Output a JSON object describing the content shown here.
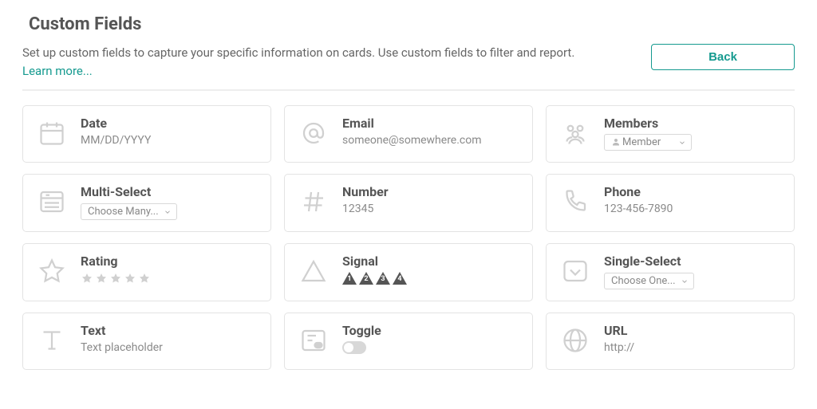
{
  "page": {
    "title": "Custom Fields",
    "intro": "Set up custom fields to capture your specific information on cards. Use custom fields to filter and report.",
    "learn_more": "Learn more...",
    "back_label": "Back"
  },
  "fields": {
    "date": {
      "title": "Date",
      "example": "MM/DD/YYYY"
    },
    "email": {
      "title": "Email",
      "example": "someone@somewhere.com"
    },
    "members": {
      "title": "Members",
      "select_label": "Member"
    },
    "multi_select": {
      "title": "Multi-Select",
      "select_label": "Choose Many..."
    },
    "number": {
      "title": "Number",
      "example": "12345"
    },
    "phone": {
      "title": "Phone",
      "example": "123-456-7890"
    },
    "rating": {
      "title": "Rating"
    },
    "signal": {
      "title": "Signal",
      "levels": [
        "1",
        "2",
        "3",
        "4"
      ]
    },
    "single_select": {
      "title": "Single-Select",
      "select_label": "Choose One..."
    },
    "text": {
      "title": "Text",
      "example": "Text placeholder"
    },
    "toggle": {
      "title": "Toggle"
    },
    "url": {
      "title": "URL",
      "example": "http://"
    }
  }
}
